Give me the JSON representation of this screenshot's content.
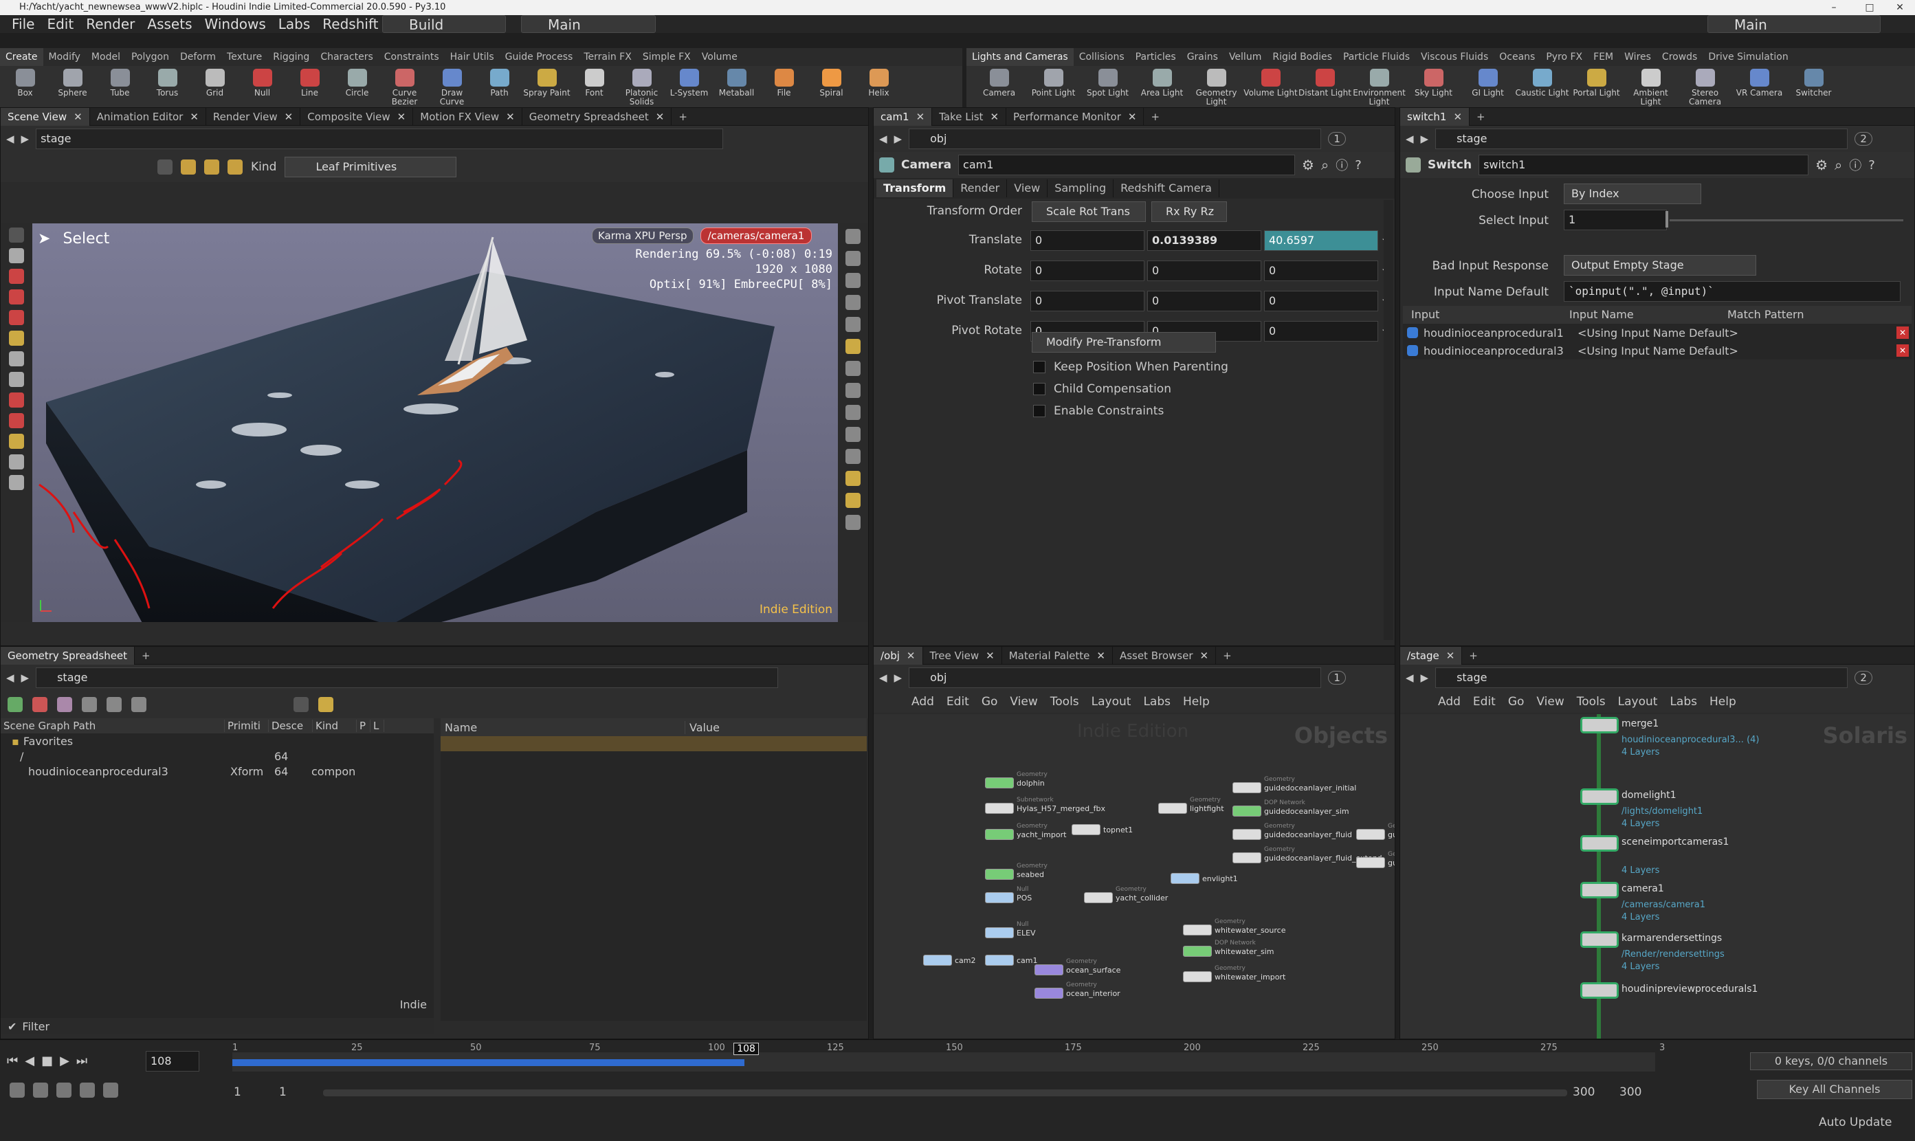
{
  "window": {
    "title": "H:/Yacht/yacht_newnewsea_wwwV2.hiplc - Houdini Indie Limited-Commercial 20.0.590 - Py3.10",
    "minimize": "–",
    "maximize": "□",
    "close": "✕"
  },
  "menubar": {
    "items": [
      "File",
      "Edit",
      "Render",
      "Assets",
      "Windows",
      "Labs",
      "Redshift",
      "Help"
    ],
    "desktop": "Build",
    "context": "Main",
    "right_context": "Main"
  },
  "shelf_left": {
    "tabs": [
      "Create",
      "Modify",
      "Model",
      "Polygon",
      "Deform",
      "Texture",
      "Rigging",
      "Characters",
      "Constraints",
      "Hair Utils",
      "Guide Process",
      "Terrain FX",
      "Simple FX",
      "Volume"
    ],
    "active_tab": 0,
    "tools": [
      "Box",
      "Sphere",
      "Tube",
      "Torus",
      "Grid",
      "Null",
      "Line",
      "Circle",
      "Curve Bezier",
      "Draw Curve",
      "Path",
      "Spray Paint",
      "Font",
      "Platonic Solids",
      "L-System",
      "Metaball",
      "File",
      "Spiral",
      "Helix"
    ]
  },
  "shelf_right": {
    "tabs": [
      "Lights and Cameras",
      "Collisions",
      "Particles",
      "Grains",
      "Vellum",
      "Rigid Bodies",
      "Particle Fluids",
      "Viscous Fluids",
      "Oceans",
      "Pyro FX",
      "FEM",
      "Wires",
      "Crowds",
      "Drive Simulation"
    ],
    "active_tab": 0,
    "tools": [
      "Camera",
      "Point Light",
      "Spot Light",
      "Area Light",
      "Geometry Light",
      "Volume Light",
      "Distant Light",
      "Environment Light",
      "Sky Light",
      "GI Light",
      "Caustic Light",
      "Portal Light",
      "Ambient Light",
      "Stereo Camera",
      "VR Camera",
      "Switcher"
    ]
  },
  "scene_view": {
    "tabs": [
      "Scene View",
      "Animation Editor",
      "Render View",
      "Composite View",
      "Motion FX View",
      "Geometry Spreadsheet"
    ],
    "path": "stage",
    "kind_label": "Kind",
    "kind_value": "Leaf Primitives",
    "select_label": "Select",
    "renderer": "Karma XPU",
    "view": "Persp",
    "camera": "/cameras/camera1",
    "render_status_1": "Rendering  69.5%  (-0:08)  0:19",
    "render_status_2": "1920 x 1080",
    "render_status_3": "Optix[ 91%] EmbreeCPU[  8%]",
    "edition": "Indie Edition"
  },
  "param_panel": {
    "tabs": [
      "cam1",
      "Take List",
      "Performance Monitor"
    ],
    "path": "obj",
    "node_type": "Camera",
    "node_name": "cam1",
    "page_tabs": [
      "Transform",
      "Render",
      "View",
      "Sampling",
      "Redshift Camera"
    ],
    "transform_order_label": "Transform Order",
    "transform_order": "Scale Rot Trans",
    "rot_order": "Rx Ry Rz",
    "rows": [
      {
        "label": "Translate",
        "x": "0",
        "y": "0.0139389",
        "z": "40.6597"
      },
      {
        "label": "Rotate",
        "x": "0",
        "y": "0",
        "z": "0"
      },
      {
        "label": "Pivot Translate",
        "x": "0",
        "y": "0",
        "z": "0"
      },
      {
        "label": "Pivot Rotate",
        "x": "0",
        "y": "0",
        "z": "0"
      }
    ],
    "modify_pre": "Modify Pre-Transform",
    "checkboxes": [
      "Keep Position When Parenting",
      "Child Compensation",
      "Enable Constraints"
    ]
  },
  "switch_panel": {
    "tab": "switch1",
    "path": "stage",
    "node_type": "Switch",
    "node_name": "switch1",
    "choose_input_label": "Choose Input",
    "choose_input": "By Index",
    "select_input_label": "Select Input",
    "select_input": "1",
    "bad_input_label": "Bad Input Response",
    "bad_input": "Output Empty Stage",
    "input_name_label": "Input Name Default",
    "input_name": "`opinput(\".\", @input)`",
    "table_headers": [
      "Input",
      "Input Name",
      "Match Pattern"
    ],
    "table_rows": [
      {
        "input": "houdinioceanprocedural1",
        "name": "<Using Input Name Default>"
      },
      {
        "input": "houdinioceanprocedural3",
        "name": "<Using Input Name Default>"
      }
    ]
  },
  "spreadsheet": {
    "tab": "Geometry Spreadsheet",
    "path": "stage",
    "columns": [
      "Scene Graph Path",
      "Primiti",
      "Descе",
      "Kind",
      "P",
      "L"
    ],
    "favorites": "Favorites",
    "rows": [
      {
        "path": "/",
        "prim": "",
        "desc": "64",
        "kind": ""
      },
      {
        "path": "houdinioceanprocedural3",
        "prim": "Xform",
        "desc": "64",
        "kind": "compon"
      }
    ],
    "name_col": "Name",
    "value_col": "Value",
    "filter": "Filter",
    "indie": "Indie"
  },
  "obj_network": {
    "tabs": [
      "/obj",
      "Tree View",
      "Material Palette",
      "Asset Browser"
    ],
    "path": "obj",
    "menu": [
      "Add",
      "Edit",
      "Go",
      "View",
      "Tools",
      "Layout",
      "Labs",
      "Help"
    ],
    "watermark": "Indie Edition",
    "context_label": "Objects",
    "nodes": [
      {
        "name": "dolphin",
        "type": "Geometry"
      },
      {
        "name": "Hylas_H57_merged_fbx",
        "type": "Subnetwork"
      },
      {
        "name": "yacht_import",
        "type": "Geometry"
      },
      {
        "name": "topnet1",
        "type": ""
      },
      {
        "name": "seabed",
        "type": "Geometry"
      },
      {
        "name": "POS",
        "type": "Null"
      },
      {
        "name": "ELEV",
        "type": "Null"
      },
      {
        "name": "cam2",
        "type": ""
      },
      {
        "name": "cam1",
        "type": ""
      },
      {
        "name": "ocean_surface",
        "type": "Geometry"
      },
      {
        "name": "ocean_interior",
        "type": "Geometry"
      },
      {
        "name": "yacht_collider",
        "type": "Geometry"
      },
      {
        "name": "envlight1",
        "type": ""
      },
      {
        "name": "lightfight",
        "type": "Geometry"
      },
      {
        "name": "guidedoceanlayer_initial",
        "type": "Geometry"
      },
      {
        "name": "guidedoceanlayer_sim",
        "type": "DOP Network"
      },
      {
        "name": "guidedoceanlayer_fluid",
        "type": "Geometry"
      },
      {
        "name": "guidedoceanlayer_fluid_extend",
        "type": "Geometry"
      },
      {
        "name": "guidedoc",
        "type": "Geometry"
      },
      {
        "name": "guidedoce",
        "type": "Geometry"
      },
      {
        "name": "whitewater_source",
        "type": "Geometry"
      },
      {
        "name": "whitewater_sim",
        "type": "DOP Network"
      },
      {
        "name": "whitewater_import",
        "type": "Geometry"
      }
    ]
  },
  "stage_network": {
    "tab": "/stage",
    "path": "stage",
    "menu": [
      "Add",
      "Edit",
      "Go",
      "View",
      "Tools",
      "Layout",
      "Labs",
      "Help"
    ],
    "context_label": "Solaris",
    "nodes": [
      {
        "name": "merge1",
        "sub1": "houdinioceanprocedural3... (4)",
        "sub2": "4 Layers"
      },
      {
        "name": "domelight1",
        "sub1": "/lights/domelight1",
        "sub2": "4 Layers"
      },
      {
        "name": "sceneimportcameras1",
        "sub1": "",
        "sub2": "4 Layers"
      },
      {
        "name": "camera1",
        "sub1": "/cameras/camera1",
        "sub2": "4 Layers"
      },
      {
        "name": "karmarendersettings",
        "sub1": "/Render/rendersettings",
        "sub2": "4 Layers"
      },
      {
        "name": "houdinipreviewprocedurals1",
        "sub1": "",
        "sub2": ""
      }
    ]
  },
  "timeline": {
    "current_frame": "108",
    "frame_marker": "108",
    "ticks": [
      "1",
      "25",
      "50",
      "75",
      "100",
      "125",
      "150",
      "175",
      "200",
      "225",
      "250",
      "275",
      "3"
    ],
    "start": "1",
    "start2": "1",
    "end": "300",
    "end2": "300",
    "keys_info": "0 keys, 0/0 channels",
    "key_all": "Key All Channels",
    "auto_update": "Auto Update",
    "progress": 0.36
  }
}
